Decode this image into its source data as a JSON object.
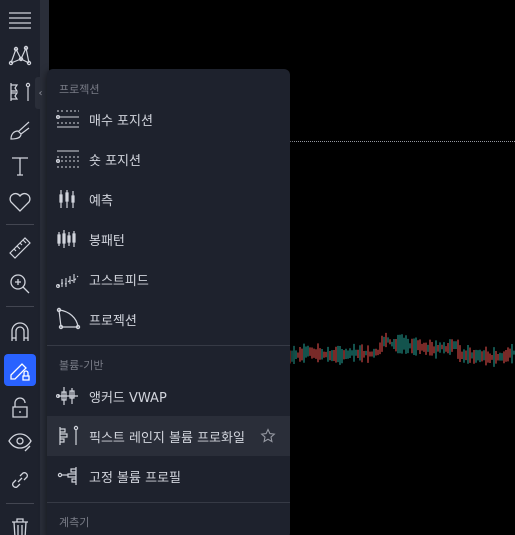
{
  "menu": {
    "sections": [
      {
        "label": "프로젝션"
      },
      {
        "label": "볼륨-기반"
      },
      {
        "label": "계측기"
      }
    ],
    "items": [
      {
        "label": "매수 포지션",
        "icon": "long-position-icon"
      },
      {
        "label": "숏 포지션",
        "icon": "short-position-icon"
      },
      {
        "label": "예측",
        "icon": "forecast-icon"
      },
      {
        "label": "봉패턴",
        "icon": "bars-pattern-icon"
      },
      {
        "label": "고스트피드",
        "icon": "ghost-feed-icon"
      },
      {
        "label": "프로젝션",
        "icon": "projection-icon"
      },
      {
        "label": "앵커드 VWAP",
        "icon": "anchored-vwap-icon"
      },
      {
        "label": "픽스트 레인지 볼륨 프로화일",
        "icon": "fixed-range-volume-profile-icon"
      },
      {
        "label": "고정 볼륨 프로필",
        "icon": "anchored-volume-profile-icon"
      }
    ]
  },
  "toolbar": {
    "tools": [
      "menu-lines-icon",
      "pattern-icon",
      "prediction-tools-icon",
      "brush-icon",
      "text-icon",
      "heart-icon",
      "ruler-icon",
      "zoom-in-icon",
      "magnet-icon",
      "lock-drawing-icon",
      "lock-icon",
      "eye-icon",
      "link-icon",
      "trash-icon"
    ]
  },
  "colors": {
    "accent": "#2962ff",
    "up": "#26a69a",
    "down": "#ef5350"
  },
  "chart_data": {
    "type": "candlestick"
  }
}
